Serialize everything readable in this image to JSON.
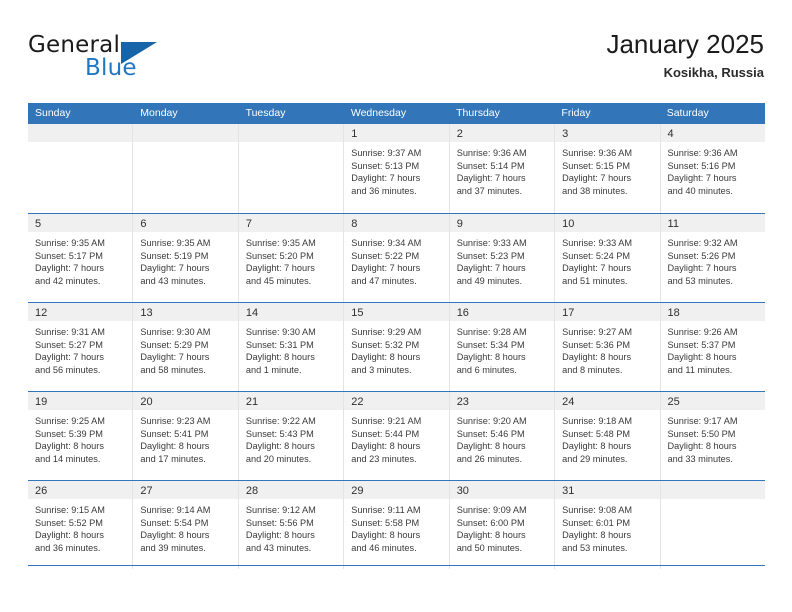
{
  "brand": {
    "name_part1": "General",
    "name_part2": "Blue",
    "flag_color": "#1565a8",
    "accent_color": "#2077c4"
  },
  "header": {
    "title": "January 2025",
    "location": "Kosikha, Russia"
  },
  "theme": {
    "header_row_color": "#3275b8",
    "day_band_color": "#f0f0f0",
    "text_color": "#3a3a3a"
  },
  "weekdays": [
    "Sunday",
    "Monday",
    "Tuesday",
    "Wednesday",
    "Thursday",
    "Friday",
    "Saturday"
  ],
  "weeks": [
    [
      {
        "day": "",
        "lines": []
      },
      {
        "day": "",
        "lines": []
      },
      {
        "day": "",
        "lines": []
      },
      {
        "day": "1",
        "lines": [
          "Sunrise: 9:37 AM",
          "Sunset: 5:13 PM",
          "Daylight: 7 hours",
          "and 36 minutes."
        ]
      },
      {
        "day": "2",
        "lines": [
          "Sunrise: 9:36 AM",
          "Sunset: 5:14 PM",
          "Daylight: 7 hours",
          "and 37 minutes."
        ]
      },
      {
        "day": "3",
        "lines": [
          "Sunrise: 9:36 AM",
          "Sunset: 5:15 PM",
          "Daylight: 7 hours",
          "and 38 minutes."
        ]
      },
      {
        "day": "4",
        "lines": [
          "Sunrise: 9:36 AM",
          "Sunset: 5:16 PM",
          "Daylight: 7 hours",
          "and 40 minutes."
        ]
      }
    ],
    [
      {
        "day": "5",
        "lines": [
          "Sunrise: 9:35 AM",
          "Sunset: 5:17 PM",
          "Daylight: 7 hours",
          "and 42 minutes."
        ]
      },
      {
        "day": "6",
        "lines": [
          "Sunrise: 9:35 AM",
          "Sunset: 5:19 PM",
          "Daylight: 7 hours",
          "and 43 minutes."
        ]
      },
      {
        "day": "7",
        "lines": [
          "Sunrise: 9:35 AM",
          "Sunset: 5:20 PM",
          "Daylight: 7 hours",
          "and 45 minutes."
        ]
      },
      {
        "day": "8",
        "lines": [
          "Sunrise: 9:34 AM",
          "Sunset: 5:22 PM",
          "Daylight: 7 hours",
          "and 47 minutes."
        ]
      },
      {
        "day": "9",
        "lines": [
          "Sunrise: 9:33 AM",
          "Sunset: 5:23 PM",
          "Daylight: 7 hours",
          "and 49 minutes."
        ]
      },
      {
        "day": "10",
        "lines": [
          "Sunrise: 9:33 AM",
          "Sunset: 5:24 PM",
          "Daylight: 7 hours",
          "and 51 minutes."
        ]
      },
      {
        "day": "11",
        "lines": [
          "Sunrise: 9:32 AM",
          "Sunset: 5:26 PM",
          "Daylight: 7 hours",
          "and 53 minutes."
        ]
      }
    ],
    [
      {
        "day": "12",
        "lines": [
          "Sunrise: 9:31 AM",
          "Sunset: 5:27 PM",
          "Daylight: 7 hours",
          "and 56 minutes."
        ]
      },
      {
        "day": "13",
        "lines": [
          "Sunrise: 9:30 AM",
          "Sunset: 5:29 PM",
          "Daylight: 7 hours",
          "and 58 minutes."
        ]
      },
      {
        "day": "14",
        "lines": [
          "Sunrise: 9:30 AM",
          "Sunset: 5:31 PM",
          "Daylight: 8 hours",
          "and 1 minute."
        ]
      },
      {
        "day": "15",
        "lines": [
          "Sunrise: 9:29 AM",
          "Sunset: 5:32 PM",
          "Daylight: 8 hours",
          "and 3 minutes."
        ]
      },
      {
        "day": "16",
        "lines": [
          "Sunrise: 9:28 AM",
          "Sunset: 5:34 PM",
          "Daylight: 8 hours",
          "and 6 minutes."
        ]
      },
      {
        "day": "17",
        "lines": [
          "Sunrise: 9:27 AM",
          "Sunset: 5:36 PM",
          "Daylight: 8 hours",
          "and 8 minutes."
        ]
      },
      {
        "day": "18",
        "lines": [
          "Sunrise: 9:26 AM",
          "Sunset: 5:37 PM",
          "Daylight: 8 hours",
          "and 11 minutes."
        ]
      }
    ],
    [
      {
        "day": "19",
        "lines": [
          "Sunrise: 9:25 AM",
          "Sunset: 5:39 PM",
          "Daylight: 8 hours",
          "and 14 minutes."
        ]
      },
      {
        "day": "20",
        "lines": [
          "Sunrise: 9:23 AM",
          "Sunset: 5:41 PM",
          "Daylight: 8 hours",
          "and 17 minutes."
        ]
      },
      {
        "day": "21",
        "lines": [
          "Sunrise: 9:22 AM",
          "Sunset: 5:43 PM",
          "Daylight: 8 hours",
          "and 20 minutes."
        ]
      },
      {
        "day": "22",
        "lines": [
          "Sunrise: 9:21 AM",
          "Sunset: 5:44 PM",
          "Daylight: 8 hours",
          "and 23 minutes."
        ]
      },
      {
        "day": "23",
        "lines": [
          "Sunrise: 9:20 AM",
          "Sunset: 5:46 PM",
          "Daylight: 8 hours",
          "and 26 minutes."
        ]
      },
      {
        "day": "24",
        "lines": [
          "Sunrise: 9:18 AM",
          "Sunset: 5:48 PM",
          "Daylight: 8 hours",
          "and 29 minutes."
        ]
      },
      {
        "day": "25",
        "lines": [
          "Sunrise: 9:17 AM",
          "Sunset: 5:50 PM",
          "Daylight: 8 hours",
          "and 33 minutes."
        ]
      }
    ],
    [
      {
        "day": "26",
        "lines": [
          "Sunrise: 9:15 AM",
          "Sunset: 5:52 PM",
          "Daylight: 8 hours",
          "and 36 minutes."
        ]
      },
      {
        "day": "27",
        "lines": [
          "Sunrise: 9:14 AM",
          "Sunset: 5:54 PM",
          "Daylight: 8 hours",
          "and 39 minutes."
        ]
      },
      {
        "day": "28",
        "lines": [
          "Sunrise: 9:12 AM",
          "Sunset: 5:56 PM",
          "Daylight: 8 hours",
          "and 43 minutes."
        ]
      },
      {
        "day": "29",
        "lines": [
          "Sunrise: 9:11 AM",
          "Sunset: 5:58 PM",
          "Daylight: 8 hours",
          "and 46 minutes."
        ]
      },
      {
        "day": "30",
        "lines": [
          "Sunrise: 9:09 AM",
          "Sunset: 6:00 PM",
          "Daylight: 8 hours",
          "and 50 minutes."
        ]
      },
      {
        "day": "31",
        "lines": [
          "Sunrise: 9:08 AM",
          "Sunset: 6:01 PM",
          "Daylight: 8 hours",
          "and 53 minutes."
        ]
      },
      {
        "day": "",
        "lines": []
      }
    ]
  ]
}
